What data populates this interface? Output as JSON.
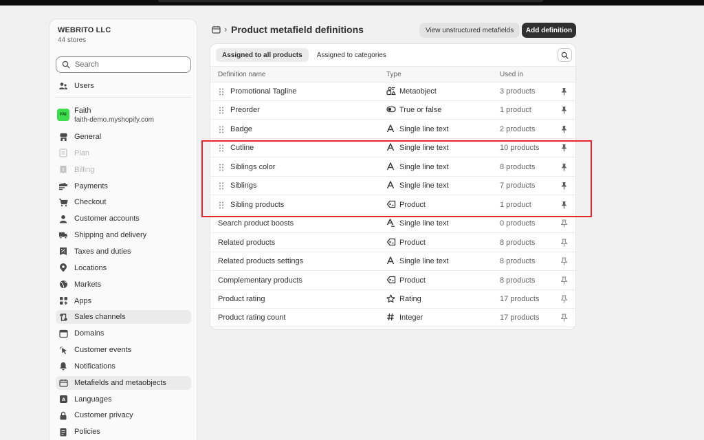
{
  "org": {
    "name": "WEBRITO LLC",
    "sub": "44 stores"
  },
  "search": {
    "placeholder": "Search"
  },
  "nav_top": {
    "users": "Users"
  },
  "store": {
    "avatar": "FAI",
    "name": "Faith",
    "domain": "faith-demo.myshopify.com"
  },
  "nav": [
    {
      "label": "General",
      "icon": "store-icon",
      "state": "normal"
    },
    {
      "label": "Plan",
      "icon": "plan-icon",
      "state": "disabled"
    },
    {
      "label": "Billing",
      "icon": "billing-icon",
      "state": "disabled"
    },
    {
      "label": "Payments",
      "icon": "payments-icon",
      "state": "normal"
    },
    {
      "label": "Checkout",
      "icon": "cart-icon",
      "state": "normal"
    },
    {
      "label": "Customer accounts",
      "icon": "person-icon",
      "state": "normal"
    },
    {
      "label": "Shipping and delivery",
      "icon": "truck-icon",
      "state": "normal"
    },
    {
      "label": "Taxes and duties",
      "icon": "tax-icon",
      "state": "normal"
    },
    {
      "label": "Locations",
      "icon": "location-icon",
      "state": "normal"
    },
    {
      "label": "Markets",
      "icon": "globe-icon",
      "state": "normal"
    },
    {
      "label": "Apps",
      "icon": "apps-icon",
      "state": "normal"
    },
    {
      "label": "Sales channels",
      "icon": "sales-channels-icon",
      "state": "active"
    },
    {
      "label": "Domains",
      "icon": "domains-icon",
      "state": "normal"
    },
    {
      "label": "Customer events",
      "icon": "cursor-icon",
      "state": "normal"
    },
    {
      "label": "Notifications",
      "icon": "bell-icon",
      "state": "normal"
    },
    {
      "label": "Metafields and metaobjects",
      "icon": "metafields-icon",
      "state": "active"
    },
    {
      "label": "Languages",
      "icon": "language-icon",
      "state": "normal"
    },
    {
      "label": "Customer privacy",
      "icon": "lock-icon",
      "state": "normal"
    },
    {
      "label": "Policies",
      "icon": "policies-icon",
      "state": "normal"
    }
  ],
  "header": {
    "title": "Product metafield definitions",
    "view_unstructured": "View unstructured metafields",
    "add_definition": "Add definition"
  },
  "tabs": [
    "Assigned to all products",
    "Assigned to categories"
  ],
  "columns": {
    "name": "Definition name",
    "type": "Type",
    "used": "Used in"
  },
  "rows": [
    {
      "name": "Promotional Tagline",
      "type": "Metaobject",
      "type_icon": "metaobject-icon",
      "used": "3 products",
      "pinned": true
    },
    {
      "name": "Preorder",
      "type": "True or false",
      "type_icon": "toggle-icon",
      "used": "1 product",
      "pinned": true
    },
    {
      "name": "Badge",
      "type": "Single line text",
      "type_icon": "text-icon",
      "used": "2 products",
      "pinned": true
    },
    {
      "name": "Cutline",
      "type": "Single line text",
      "type_icon": "text-icon",
      "used": "10 products",
      "pinned": true
    },
    {
      "name": "Siblings color",
      "type": "Single line text",
      "type_icon": "text-icon",
      "used": "8 products",
      "pinned": true
    },
    {
      "name": "Siblings",
      "type": "Single line text",
      "type_icon": "text-icon",
      "used": "7 products",
      "pinned": true
    },
    {
      "name": "Sibling products",
      "type": "Product",
      "type_icon": "product-tag-icon",
      "used": "1 product",
      "pinned": true
    },
    {
      "name": "Search product boosts",
      "type": "Single line text",
      "type_icon": "text-list-icon",
      "used": "0 products",
      "pinned": false
    },
    {
      "name": "Related products",
      "type": "Product",
      "type_icon": "product-tag-icon",
      "used": "8 products",
      "pinned": false
    },
    {
      "name": "Related products settings",
      "type": "Single line text",
      "type_icon": "text-icon",
      "used": "8 products",
      "pinned": false
    },
    {
      "name": "Complementary products",
      "type": "Product",
      "type_icon": "product-tag-icon",
      "used": "8 products",
      "pinned": false
    },
    {
      "name": "Product rating",
      "type": "Rating",
      "type_icon": "star-icon",
      "used": "17 products",
      "pinned": false
    },
    {
      "name": "Product rating count",
      "type": "Integer",
      "type_icon": "hash-icon",
      "used": "17 products",
      "pinned": false
    }
  ],
  "colors": {
    "highlight": "#e5242b",
    "primary_button": "#303030",
    "store_avatar": "#3ddc4c"
  }
}
